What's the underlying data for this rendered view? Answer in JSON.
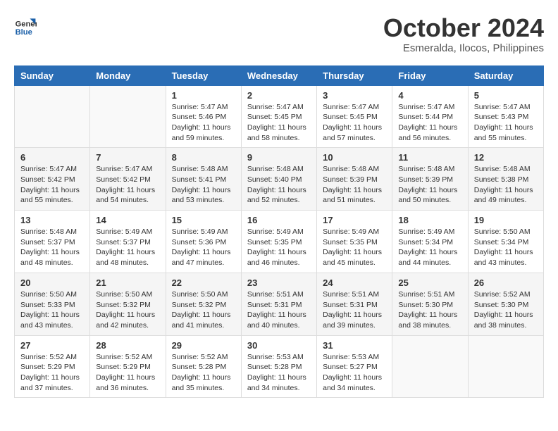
{
  "logo": {
    "line1": "General",
    "line2": "Blue"
  },
  "title": "October 2024",
  "subtitle": "Esmeralda, Ilocos, Philippines",
  "weekdays": [
    "Sunday",
    "Monday",
    "Tuesday",
    "Wednesday",
    "Thursday",
    "Friday",
    "Saturday"
  ],
  "weeks": [
    [
      {
        "day": "",
        "info": ""
      },
      {
        "day": "",
        "info": ""
      },
      {
        "day": "1",
        "info": "Sunrise: 5:47 AM\nSunset: 5:46 PM\nDaylight: 11 hours and 59 minutes."
      },
      {
        "day": "2",
        "info": "Sunrise: 5:47 AM\nSunset: 5:45 PM\nDaylight: 11 hours and 58 minutes."
      },
      {
        "day": "3",
        "info": "Sunrise: 5:47 AM\nSunset: 5:45 PM\nDaylight: 11 hours and 57 minutes."
      },
      {
        "day": "4",
        "info": "Sunrise: 5:47 AM\nSunset: 5:44 PM\nDaylight: 11 hours and 56 minutes."
      },
      {
        "day": "5",
        "info": "Sunrise: 5:47 AM\nSunset: 5:43 PM\nDaylight: 11 hours and 55 minutes."
      }
    ],
    [
      {
        "day": "6",
        "info": "Sunrise: 5:47 AM\nSunset: 5:42 PM\nDaylight: 11 hours and 55 minutes."
      },
      {
        "day": "7",
        "info": "Sunrise: 5:47 AM\nSunset: 5:42 PM\nDaylight: 11 hours and 54 minutes."
      },
      {
        "day": "8",
        "info": "Sunrise: 5:48 AM\nSunset: 5:41 PM\nDaylight: 11 hours and 53 minutes."
      },
      {
        "day": "9",
        "info": "Sunrise: 5:48 AM\nSunset: 5:40 PM\nDaylight: 11 hours and 52 minutes."
      },
      {
        "day": "10",
        "info": "Sunrise: 5:48 AM\nSunset: 5:39 PM\nDaylight: 11 hours and 51 minutes."
      },
      {
        "day": "11",
        "info": "Sunrise: 5:48 AM\nSunset: 5:39 PM\nDaylight: 11 hours and 50 minutes."
      },
      {
        "day": "12",
        "info": "Sunrise: 5:48 AM\nSunset: 5:38 PM\nDaylight: 11 hours and 49 minutes."
      }
    ],
    [
      {
        "day": "13",
        "info": "Sunrise: 5:48 AM\nSunset: 5:37 PM\nDaylight: 11 hours and 48 minutes."
      },
      {
        "day": "14",
        "info": "Sunrise: 5:49 AM\nSunset: 5:37 PM\nDaylight: 11 hours and 48 minutes."
      },
      {
        "day": "15",
        "info": "Sunrise: 5:49 AM\nSunset: 5:36 PM\nDaylight: 11 hours and 47 minutes."
      },
      {
        "day": "16",
        "info": "Sunrise: 5:49 AM\nSunset: 5:35 PM\nDaylight: 11 hours and 46 minutes."
      },
      {
        "day": "17",
        "info": "Sunrise: 5:49 AM\nSunset: 5:35 PM\nDaylight: 11 hours and 45 minutes."
      },
      {
        "day": "18",
        "info": "Sunrise: 5:49 AM\nSunset: 5:34 PM\nDaylight: 11 hours and 44 minutes."
      },
      {
        "day": "19",
        "info": "Sunrise: 5:50 AM\nSunset: 5:34 PM\nDaylight: 11 hours and 43 minutes."
      }
    ],
    [
      {
        "day": "20",
        "info": "Sunrise: 5:50 AM\nSunset: 5:33 PM\nDaylight: 11 hours and 43 minutes."
      },
      {
        "day": "21",
        "info": "Sunrise: 5:50 AM\nSunset: 5:32 PM\nDaylight: 11 hours and 42 minutes."
      },
      {
        "day": "22",
        "info": "Sunrise: 5:50 AM\nSunset: 5:32 PM\nDaylight: 11 hours and 41 minutes."
      },
      {
        "day": "23",
        "info": "Sunrise: 5:51 AM\nSunset: 5:31 PM\nDaylight: 11 hours and 40 minutes."
      },
      {
        "day": "24",
        "info": "Sunrise: 5:51 AM\nSunset: 5:31 PM\nDaylight: 11 hours and 39 minutes."
      },
      {
        "day": "25",
        "info": "Sunrise: 5:51 AM\nSunset: 5:30 PM\nDaylight: 11 hours and 38 minutes."
      },
      {
        "day": "26",
        "info": "Sunrise: 5:52 AM\nSunset: 5:30 PM\nDaylight: 11 hours and 38 minutes."
      }
    ],
    [
      {
        "day": "27",
        "info": "Sunrise: 5:52 AM\nSunset: 5:29 PM\nDaylight: 11 hours and 37 minutes."
      },
      {
        "day": "28",
        "info": "Sunrise: 5:52 AM\nSunset: 5:29 PM\nDaylight: 11 hours and 36 minutes."
      },
      {
        "day": "29",
        "info": "Sunrise: 5:52 AM\nSunset: 5:28 PM\nDaylight: 11 hours and 35 minutes."
      },
      {
        "day": "30",
        "info": "Sunrise: 5:53 AM\nSunset: 5:28 PM\nDaylight: 11 hours and 34 minutes."
      },
      {
        "day": "31",
        "info": "Sunrise: 5:53 AM\nSunset: 5:27 PM\nDaylight: 11 hours and 34 minutes."
      },
      {
        "day": "",
        "info": ""
      },
      {
        "day": "",
        "info": ""
      }
    ]
  ]
}
